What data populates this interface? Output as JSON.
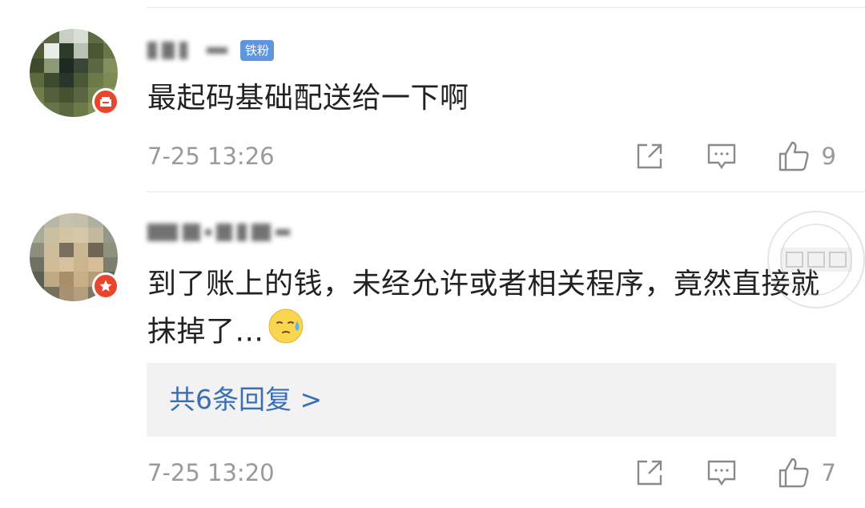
{
  "comments": [
    {
      "username_obscured": true,
      "fan_badge": "铁粉",
      "text": "最起码基础配送给一下啊",
      "timestamp": "7-25 13:26",
      "like_count": "9",
      "icons": [
        "share-icon",
        "comment-icon",
        "like-icon"
      ]
    },
    {
      "username_obscured": true,
      "text": "到了账上的钱，未经允许或者相关程序，竟然直接就抹掉了...",
      "emoji": "sweat-face-emoji",
      "replies_label": "共6条回复 >",
      "timestamp": "7-25 13:20",
      "like_count": "7",
      "icons": [
        "share-icon",
        "comment-icon",
        "like-icon"
      ]
    }
  ],
  "watermark": {
    "text": "横县网"
  },
  "colors": {
    "text": "#222222",
    "meta": "#9a9a9a",
    "link": "#3b6fb5",
    "fan_badge": "#5f94e0",
    "avatar_badge": "#e8452c",
    "reply_bg": "#f2f2f2"
  }
}
